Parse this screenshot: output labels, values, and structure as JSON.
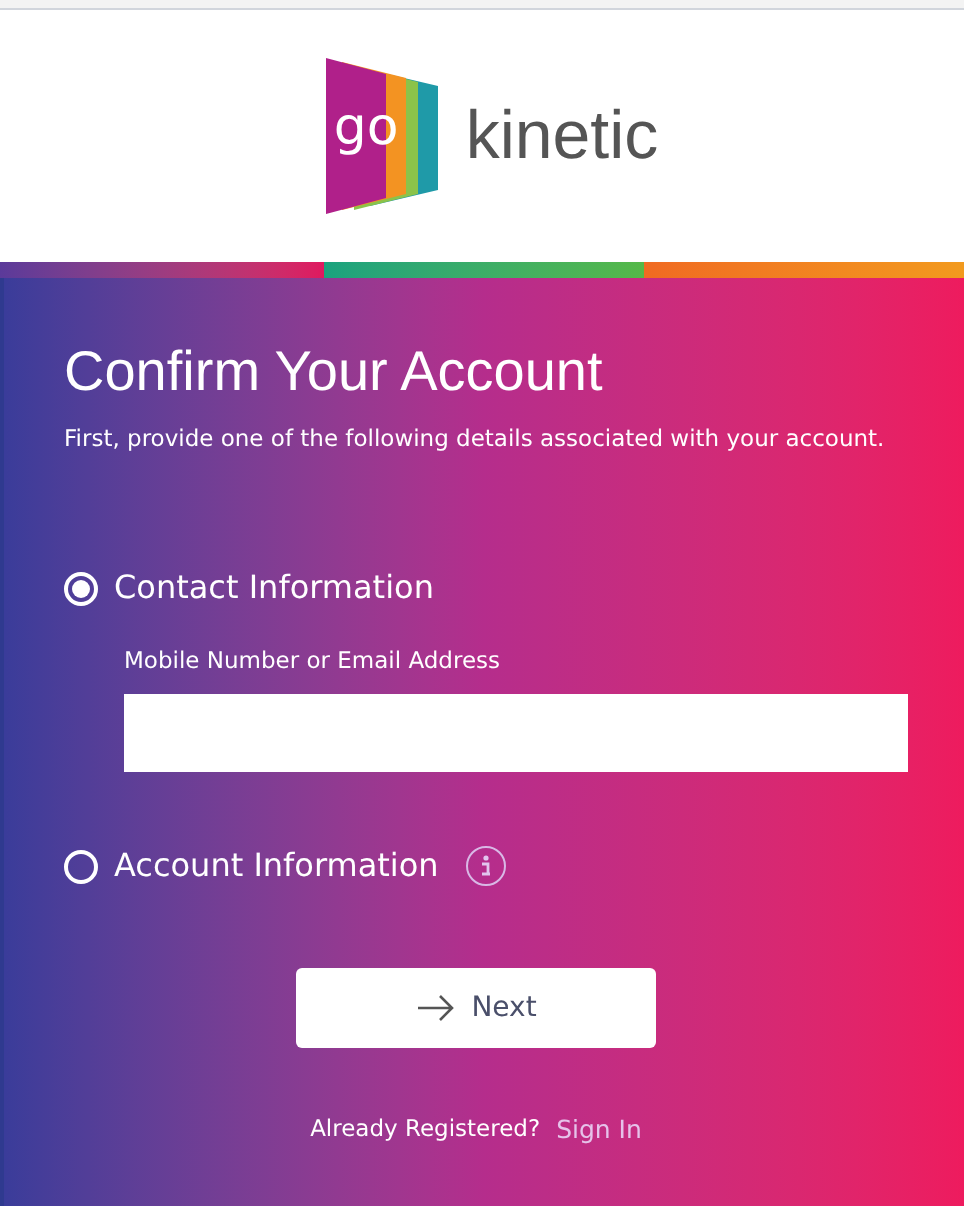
{
  "logo": {
    "mark": "go",
    "wordmark": "kinetic"
  },
  "title": "Confirm Your Account",
  "subtitle": "First, provide one of the following details associated with your account.",
  "options": [
    {
      "label": "Contact Information",
      "selected": true,
      "info": false,
      "field": {
        "label": "Mobile Number or Email Address"
      }
    },
    {
      "label": "Account Information",
      "selected": false,
      "info": true
    }
  ],
  "next_button": "Next",
  "footer": {
    "prompt": "Already Registered?",
    "link": "Sign In"
  }
}
